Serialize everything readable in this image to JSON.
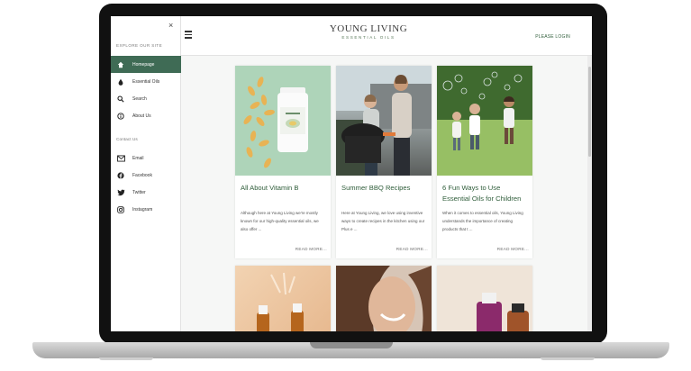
{
  "header": {
    "logo_main": "YOUNG LIVING",
    "logo_sub": "ESSENTIAL OILS",
    "login": "PLEASE LOGIN"
  },
  "sidebar": {
    "close": "×",
    "explore_label": "EXPLORE OUR SITE",
    "nav": [
      {
        "label": "Homepage",
        "icon": "home-icon"
      },
      {
        "label": "Essential Oils",
        "icon": "drop-icon"
      },
      {
        "label": "Search",
        "icon": "search-icon"
      },
      {
        "label": "About Us",
        "icon": "info-icon"
      }
    ],
    "contact_label": "Contact Us",
    "contact": [
      {
        "label": "Email",
        "icon": "email-icon"
      },
      {
        "label": "Facebook",
        "icon": "facebook-icon"
      },
      {
        "label": "Twitter",
        "icon": "twitter-icon"
      },
      {
        "label": "Instagram",
        "icon": "instagram-icon"
      }
    ]
  },
  "cards": [
    {
      "title": "All About Vitamin B",
      "body": "Although here at Young Living we're mostly known for our high-quality essential oils, we also offer ...",
      "read_more": "READ MORE..."
    },
    {
      "title": "Summer BBQ Recipes",
      "body": "Here at Young Living, we love using inventive ways to create recipes in the kitchen using our Plus e ...",
      "read_more": "READ MORE..."
    },
    {
      "title": "6 Fun Ways to Use Essential Oils for Children",
      "body": "When it comes to essential oils, Young Living understands the importance of creating products that t ...",
      "read_more": "READ MORE..."
    }
  ],
  "colors": {
    "brand_green": "#3f6b55",
    "title_green": "#2f5d3a"
  }
}
